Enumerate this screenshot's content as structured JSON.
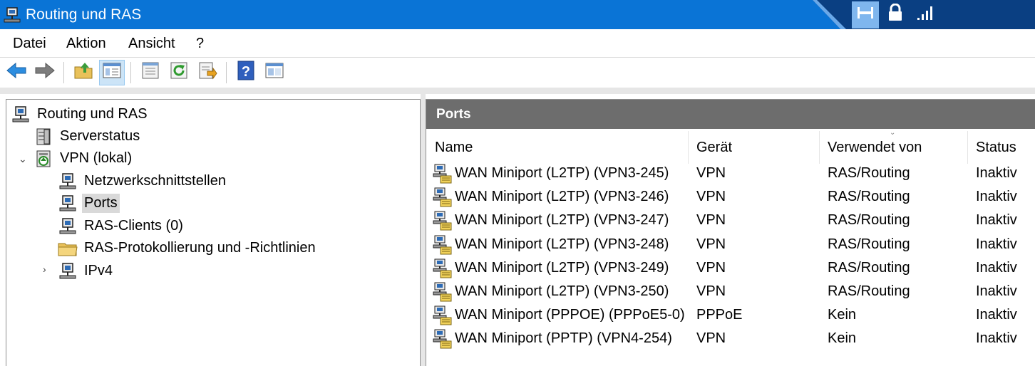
{
  "window": {
    "title": "Routing und RAS"
  },
  "menu": {
    "items": [
      "Datei",
      "Aktion",
      "Ansicht",
      "?"
    ]
  },
  "tree": {
    "items": [
      {
        "label": "Routing und RAS"
      },
      {
        "label": "Serverstatus"
      },
      {
        "label": "VPN (lokal)"
      },
      {
        "label": "Netzwerkschnittstellen"
      },
      {
        "label": "Ports"
      },
      {
        "label": "RAS-Clients (0)"
      },
      {
        "label": "RAS-Protokollierung und -Richtlinien"
      },
      {
        "label": "IPv4"
      }
    ]
  },
  "result": {
    "title": "Ports",
    "columns": [
      "Name",
      "Gerät",
      "Verwendet von",
      "Status"
    ],
    "rows": [
      {
        "name": "WAN Miniport (L2TP) (VPN3-245)",
        "device": "VPN",
        "used_by": "RAS/Routing",
        "status": "Inaktiv"
      },
      {
        "name": "WAN Miniport (L2TP) (VPN3-246)",
        "device": "VPN",
        "used_by": "RAS/Routing",
        "status": "Inaktiv"
      },
      {
        "name": "WAN Miniport (L2TP) (VPN3-247)",
        "device": "VPN",
        "used_by": "RAS/Routing",
        "status": "Inaktiv"
      },
      {
        "name": "WAN Miniport (L2TP) (VPN3-248)",
        "device": "VPN",
        "used_by": "RAS/Routing",
        "status": "Inaktiv"
      },
      {
        "name": "WAN Miniport (L2TP) (VPN3-249)",
        "device": "VPN",
        "used_by": "RAS/Routing",
        "status": "Inaktiv"
      },
      {
        "name": "WAN Miniport (L2TP) (VPN3-250)",
        "device": "VPN",
        "used_by": "RAS/Routing",
        "status": "Inaktiv"
      },
      {
        "name": "WAN Miniport (PPPOE) (PPPoE5-0)",
        "device": "PPPoE",
        "used_by": "Kein",
        "status": "Inaktiv"
      },
      {
        "name": "WAN Miniport (PPTP) (VPN4-254)",
        "device": "VPN",
        "used_by": "Kein",
        "status": "Inaktiv"
      }
    ]
  },
  "colors": {
    "titlebar": "#0a74d6",
    "pane_header": "#6d6d6d",
    "selection": "#d9d9d9",
    "toolbar_active": "#cce4f7"
  },
  "icons": {
    "toolbar": [
      "back-arrow-icon",
      "forward-arrow-icon",
      "up-folder-icon",
      "show-hide-tree-icon",
      "properties-icon",
      "refresh-icon",
      "export-list-icon",
      "help-icon",
      "mmc-console-icon"
    ],
    "connection_bar": [
      "pin-icon",
      "lock-icon",
      "signal-bars-icon"
    ]
  }
}
